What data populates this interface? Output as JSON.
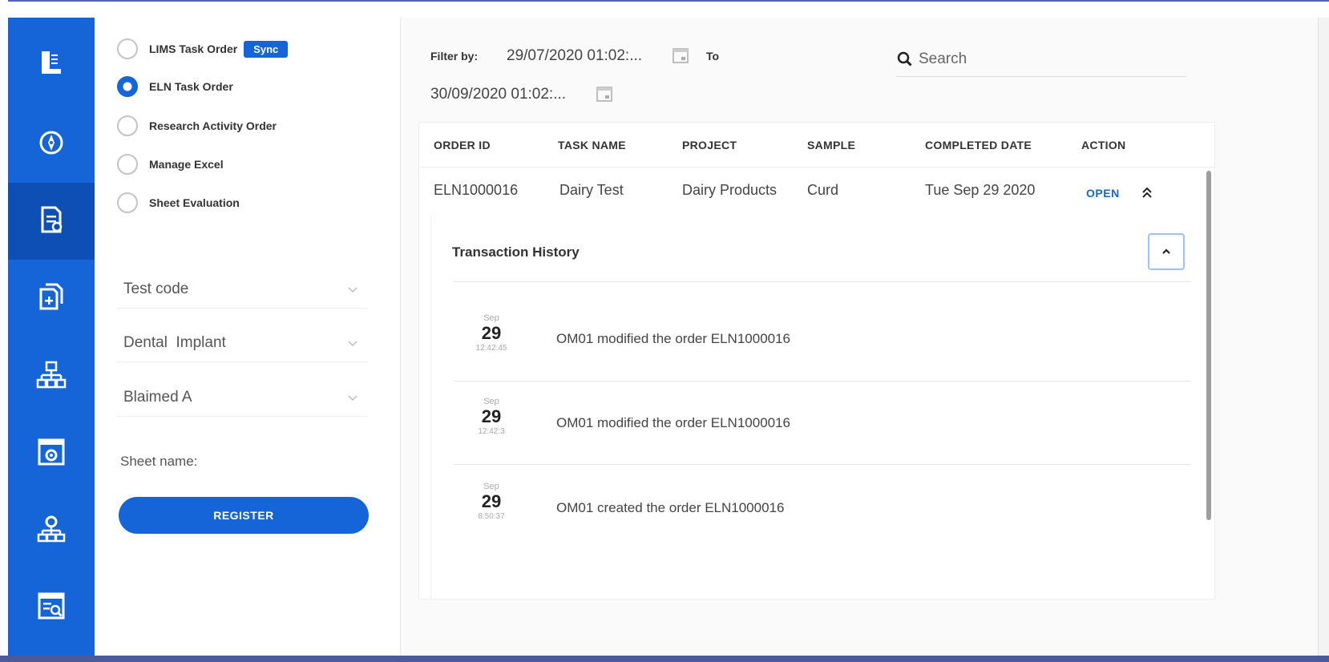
{
  "sidebar": {
    "items": [
      {
        "icon": "logo-icon"
      },
      {
        "icon": "compass-icon"
      },
      {
        "icon": "document-edit-icon"
      },
      {
        "icon": "document-add-icon"
      },
      {
        "icon": "hierarchy-icon"
      },
      {
        "icon": "settings-window-icon"
      },
      {
        "icon": "network-settings-icon"
      },
      {
        "icon": "report-search-icon"
      }
    ],
    "active_index": 2,
    "color": "#1565d8"
  },
  "options": {
    "radios": [
      {
        "label": "LIMS Task Order",
        "checked": false,
        "badge": "Sync"
      },
      {
        "label": "ELN Task Order",
        "checked": true
      },
      {
        "label": "Research Activity Order",
        "checked": false
      },
      {
        "label": "Manage Excel",
        "checked": false
      },
      {
        "label": "Sheet Evaluation",
        "checked": false
      }
    ],
    "selects": [
      {
        "value": "Test code"
      },
      {
        "value": "Dental  Implant"
      },
      {
        "value": "Blaimed A"
      }
    ],
    "sheet_name_label": "Sheet name:",
    "register_label": "REGISTER"
  },
  "filter": {
    "label": "Filter by:",
    "from_date": "29/07/2020 01:02:...",
    "to_label": "To",
    "to_date": "30/09/2020 01:02:...",
    "search_placeholder": "Search"
  },
  "table": {
    "headers": [
      "ORDER ID",
      "TASK NAME",
      "PROJECT",
      "SAMPLE",
      "COMPLETED DATE",
      "ACTION"
    ],
    "rows": [
      {
        "order_id": "ELN1000016",
        "task_name": "Dairy Test",
        "project": "Dairy Products",
        "sample": "Curd",
        "completed_date": "Tue Sep 29 2020",
        "action": "OPEN"
      }
    ]
  },
  "history": {
    "title": "Transaction History",
    "entries": [
      {
        "month": "Sep",
        "day": "29",
        "time": "12:42:45",
        "text": "OM01 modified the order ELN1000016"
      },
      {
        "month": "Sep",
        "day": "29",
        "time": "12:42:3",
        "text": "OM01 modified the order ELN1000016"
      },
      {
        "month": "Sep",
        "day": "29",
        "time": "8:50:37",
        "text": "OM01 created the order ELN1000016"
      }
    ]
  },
  "colors": {
    "accent": "#1565d8",
    "sidebar_active": "#0d4fb5"
  }
}
